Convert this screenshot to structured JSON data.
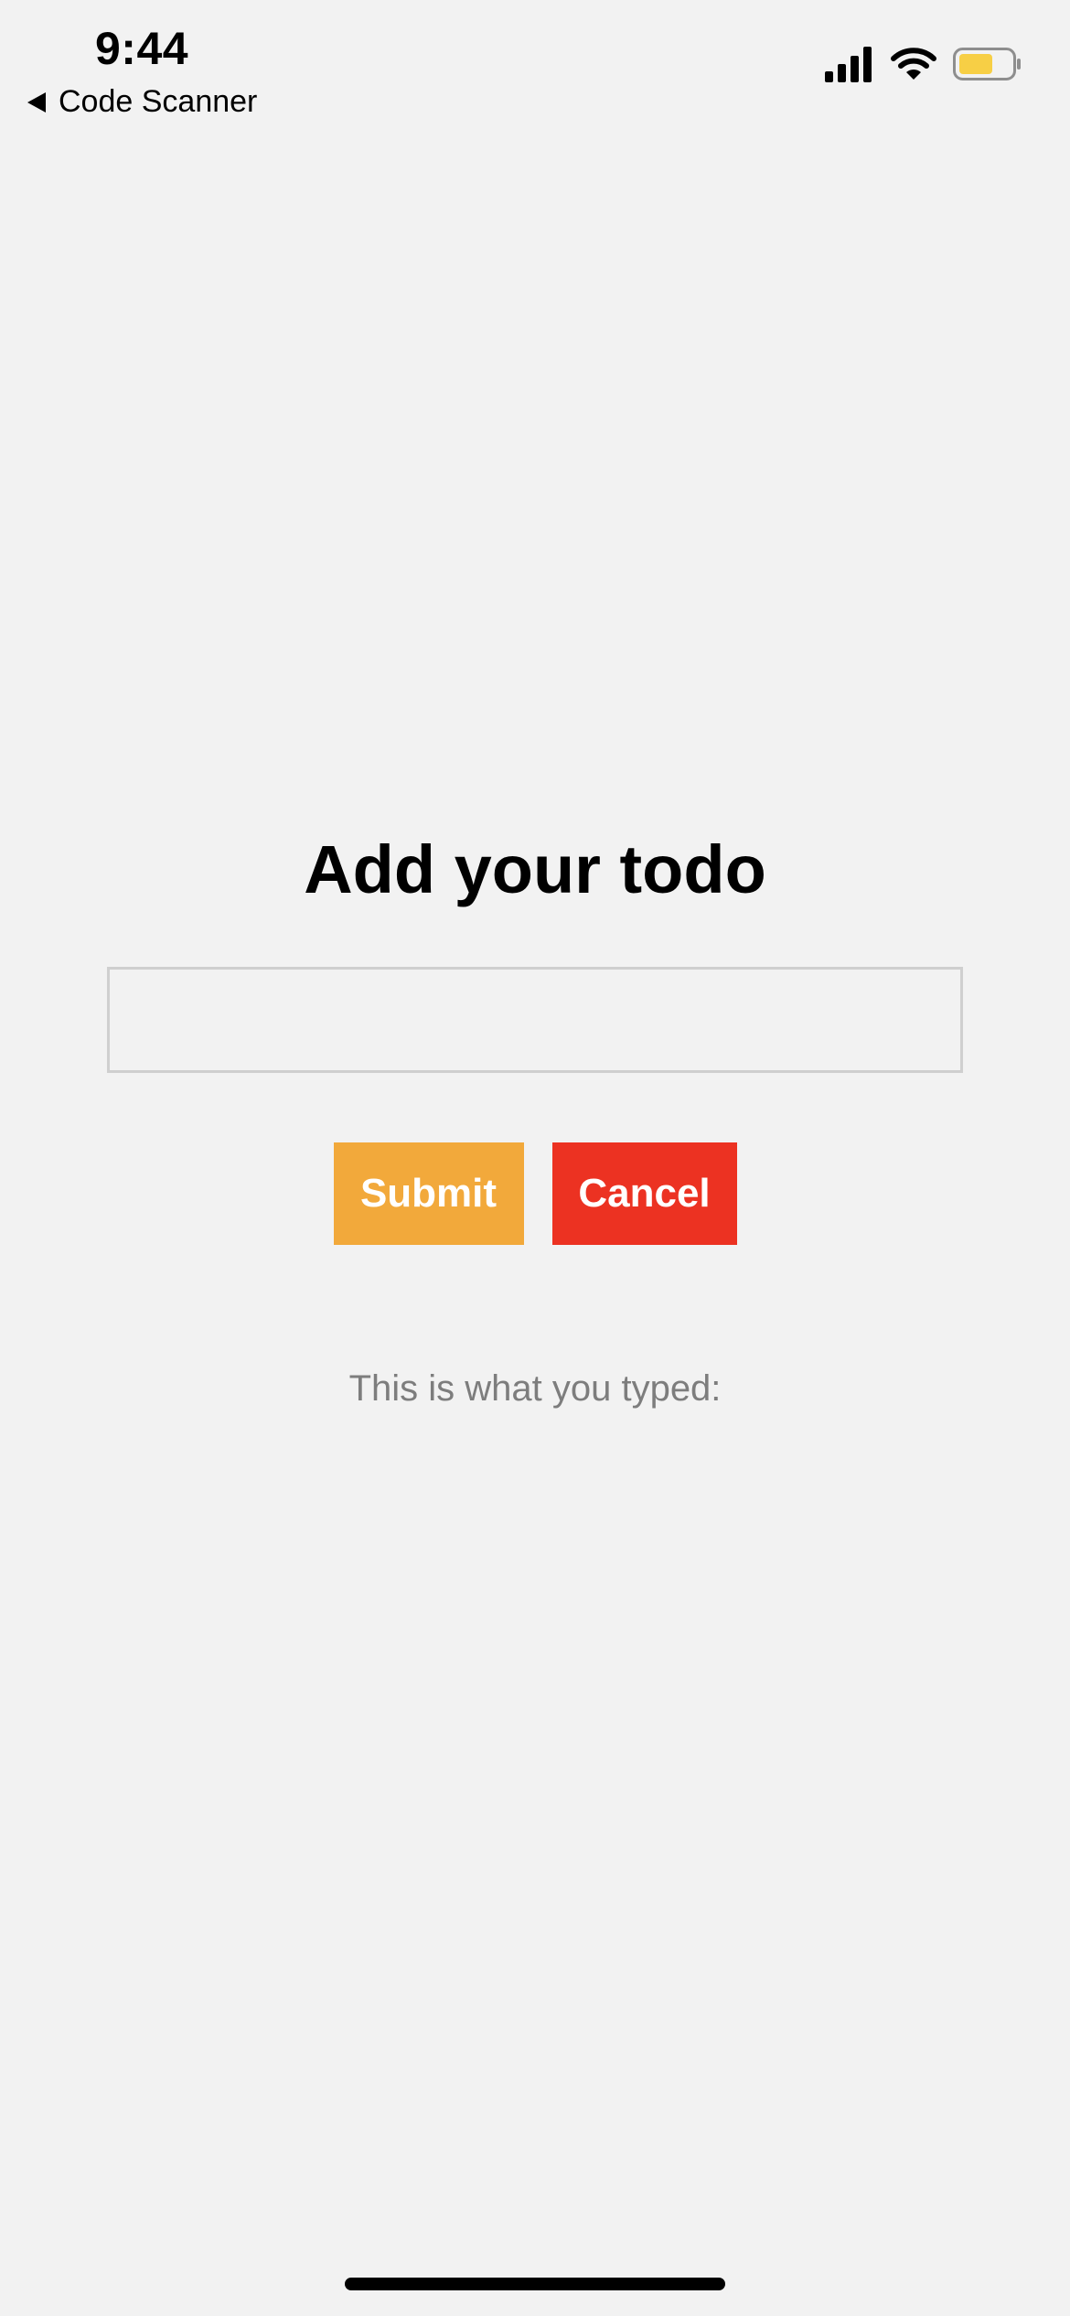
{
  "status_bar": {
    "time": "9:44",
    "back_label": "Code Scanner",
    "icons": [
      "cellular-signal-icon",
      "wifi-icon",
      "battery-icon"
    ],
    "battery_fill_color": "#f7cf45"
  },
  "main": {
    "title": "Add your todo",
    "input": {
      "value": "",
      "placeholder": ""
    },
    "submit_label": "Submit",
    "cancel_label": "Cancel",
    "typed_label": "This is what you typed:"
  },
  "colors": {
    "background": "#f2f2f2",
    "submit": "#f2a93b",
    "cancel": "#ec3222",
    "muted_text": "#7d7d7d"
  }
}
